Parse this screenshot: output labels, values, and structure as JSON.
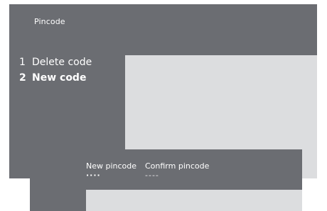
{
  "screen": {
    "title": "Pincode"
  },
  "menu": {
    "items": [
      {
        "number": "1",
        "label": "Delete code",
        "selected": false
      },
      {
        "number": "2",
        "label": "New code",
        "selected": true
      }
    ]
  },
  "dialog": {
    "new_pincode": {
      "label": "New pincode",
      "value": "····"
    },
    "confirm_pincode": {
      "label": "Confirm pincode",
      "value": "----"
    }
  },
  "colors": {
    "panel_dark": "#6b6d72",
    "panel_light": "#dcdddf",
    "text": "#ffffff"
  }
}
